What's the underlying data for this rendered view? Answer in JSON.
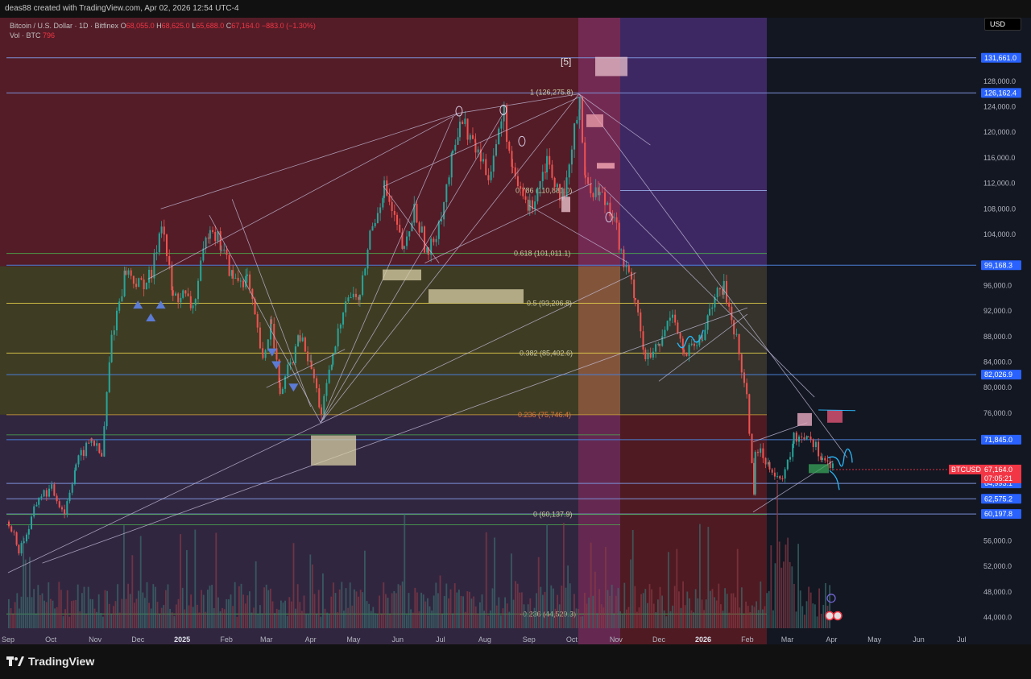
{
  "header": {
    "credit": "deas88 created with TradingView.com, Apr 02, 2026 12:54 UTC-4",
    "symbol": "Bitcoin / U.S. Dollar · 1D · Bitfinex",
    "ohlc": {
      "o": "68,055.0",
      "h": "68,625.0",
      "l": "65,688.0",
      "c": "67,164.0",
      "change": "−883.0 (−1.30%)"
    },
    "volume_label": "Vol · BTC",
    "volume_value": "796",
    "currency": "USD"
  },
  "footer": {
    "brand": "TradingView"
  },
  "colors": {
    "background": "#131722",
    "up": "#26a69a",
    "down": "#ef5350",
    "price_tag": "#f23645",
    "level_tag": "#2962ff",
    "fib_line": "#e5d04a",
    "fib_green": "#4caf50",
    "annotation": "#29b6f6",
    "marker": "#5b7bd5"
  },
  "chart_data": {
    "type": "candlestick",
    "symbol": "BTCUSD",
    "timeframe": "1D",
    "ylim": [
      42000,
      134000
    ],
    "y_ticks": [
      44000,
      48000,
      52000,
      56000,
      60000,
      64000,
      68000,
      72000,
      76000,
      80000,
      84000,
      88000,
      92000,
      96000,
      100000,
      104000,
      108000,
      112000,
      116000,
      120000,
      124000,
      128000
    ],
    "y_tick_labels": [
      "44,000.0",
      "48,000.0",
      "52,000.0",
      "56,000.0",
      "60,000.0",
      "64,000.0",
      "68,000.0",
      "72,000.0",
      "76,000.0",
      "80,000.0",
      "84,000.0",
      "88,000.0",
      "92,000.0",
      "96,000.0",
      "100,000.0",
      "104,000.0",
      "108,000.0",
      "112,000.0",
      "116,000.0",
      "120,000.0",
      "124,000.0",
      "128,000.0"
    ],
    "x_ticks": [
      "Sep",
      "Oct",
      "Nov",
      "Dec",
      "2025",
      "Feb",
      "Mar",
      "Apr",
      "May",
      "Jun",
      "Jul",
      "Aug",
      "Sep",
      "Oct",
      "Nov",
      "Dec",
      "2026",
      "Feb",
      "Mar",
      "Apr",
      "May",
      "Jun",
      "Jul"
    ],
    "x_tick_dates": [
      "2024-09-01",
      "2024-10-01",
      "2024-11-01",
      "2024-12-01",
      "2025-01-01",
      "2025-02-01",
      "2025-03-01",
      "2025-04-01",
      "2025-05-01",
      "2025-06-01",
      "2025-07-01",
      "2025-08-01",
      "2025-09-01",
      "2025-10-01",
      "2025-11-01",
      "2025-12-01",
      "2026-01-01",
      "2026-02-01",
      "2026-03-01",
      "2026-04-01",
      "2026-05-01",
      "2026-06-01",
      "2026-07-01"
    ],
    "current_price": {
      "label": "BTCUSD",
      "value": 67164,
      "text": "67,164.0",
      "countdown": "07:05:21"
    },
    "horizontal_levels": [
      {
        "value": 131661,
        "text": "131,661.0"
      },
      {
        "value": 126162.4,
        "text": "126,162.4"
      },
      {
        "value": 99168.3,
        "text": "99,168.3"
      },
      {
        "value": 82026.9,
        "text": "82,026.9"
      },
      {
        "value": 71845,
        "text": "71,845.0"
      },
      {
        "value": 64993.1,
        "text": "64,993.1"
      },
      {
        "value": 62575.2,
        "text": "62,575.2"
      },
      {
        "value": 60197.8,
        "text": "60,197.8"
      }
    ],
    "fib_retracement": [
      {
        "ratio": "1",
        "value": 126275.8,
        "text": "1 (126,275.8)"
      },
      {
        "ratio": "0.786",
        "value": 110881,
        "text": "0.786 (110,881.0)"
      },
      {
        "ratio": "0.618",
        "value": 101011.1,
        "text": "0.618 (101,011.1)"
      },
      {
        "ratio": "0.5",
        "value": 93206.8,
        "text": "0.5 (93,206.8)"
      },
      {
        "ratio": "0.382",
        "value": 85402.6,
        "text": "0.382 (85,402.6)"
      },
      {
        "ratio": "0.236",
        "value": 75746.4,
        "text": "0.236 (75,746.4)"
      },
      {
        "ratio": "0",
        "value": 60137.9,
        "text": "0 (60,137.9)"
      },
      {
        "ratio": "-0.236",
        "value": 44529.3,
        "text": "-0.236 (44,529.3)"
      }
    ],
    "wave_label": "[5]",
    "price_path": [
      [
        "2024-09-01",
        59000
      ],
      [
        "2024-09-08",
        54500
      ],
      [
        "2024-09-15",
        58000
      ],
      [
        "2024-09-22",
        63000
      ],
      [
        "2024-10-01",
        64000
      ],
      [
        "2024-10-10",
        60500
      ],
      [
        "2024-10-18",
        68000
      ],
      [
        "2024-10-29",
        72000
      ],
      [
        "2024-11-05",
        69000
      ],
      [
        "2024-11-12",
        88000
      ],
      [
        "2024-11-22",
        98500
      ],
      [
        "2024-12-01",
        96000
      ],
      [
        "2024-12-10",
        97500
      ],
      [
        "2024-12-17",
        106500
      ],
      [
        "2024-12-25",
        94000
      ],
      [
        "2025-01-01",
        94500
      ],
      [
        "2025-01-08",
        92500
      ],
      [
        "2025-01-20",
        106000
      ],
      [
        "2025-01-28",
        102000
      ],
      [
        "2025-02-05",
        97000
      ],
      [
        "2025-02-15",
        97000
      ],
      [
        "2025-02-26",
        84000
      ],
      [
        "2025-03-04",
        91000
      ],
      [
        "2025-03-10",
        79000
      ],
      [
        "2025-03-24",
        88000
      ],
      [
        "2025-04-01",
        83000
      ],
      [
        "2025-04-08",
        76000
      ],
      [
        "2025-04-16",
        84500
      ],
      [
        "2025-04-25",
        94500
      ],
      [
        "2025-05-05",
        94000
      ],
      [
        "2025-05-12",
        104000
      ],
      [
        "2025-05-22",
        111500
      ],
      [
        "2025-06-05",
        101000
      ],
      [
        "2025-06-12",
        108000
      ],
      [
        "2025-06-22",
        100500
      ],
      [
        "2025-07-01",
        107500
      ],
      [
        "2025-07-09",
        116000
      ],
      [
        "2025-07-14",
        122500
      ],
      [
        "2025-07-25",
        117500
      ],
      [
        "2025-08-03",
        113500
      ],
      [
        "2025-08-14",
        123000
      ],
      [
        "2025-08-20",
        113000
      ],
      [
        "2025-09-01",
        108000
      ],
      [
        "2025-09-13",
        116000
      ],
      [
        "2025-09-25",
        109000
      ],
      [
        "2025-10-06",
        125500
      ],
      [
        "2025-10-10",
        112000
      ],
      [
        "2025-10-20",
        110500
      ],
      [
        "2025-10-30",
        107500
      ],
      [
        "2025-11-04",
        100500
      ],
      [
        "2025-11-14",
        94500
      ],
      [
        "2025-11-21",
        84000
      ],
      [
        "2025-12-01",
        86500
      ],
      [
        "2025-12-10",
        92500
      ],
      [
        "2025-12-18",
        85000
      ],
      [
        "2025-12-31",
        87500
      ],
      [
        "2026-01-05",
        93000
      ],
      [
        "2026-01-15",
        95500
      ],
      [
        "2026-01-22",
        89500
      ],
      [
        "2026-01-31",
        78500
      ],
      [
        "2026-02-05",
        64000
      ],
      [
        "2026-02-06",
        70500
      ],
      [
        "2026-02-16",
        68000
      ],
      [
        "2026-02-25",
        65000
      ],
      [
        "2026-03-05",
        72000
      ],
      [
        "2026-03-15",
        72800
      ],
      [
        "2026-03-25",
        69000
      ],
      [
        "2026-04-02",
        67164
      ]
    ]
  }
}
